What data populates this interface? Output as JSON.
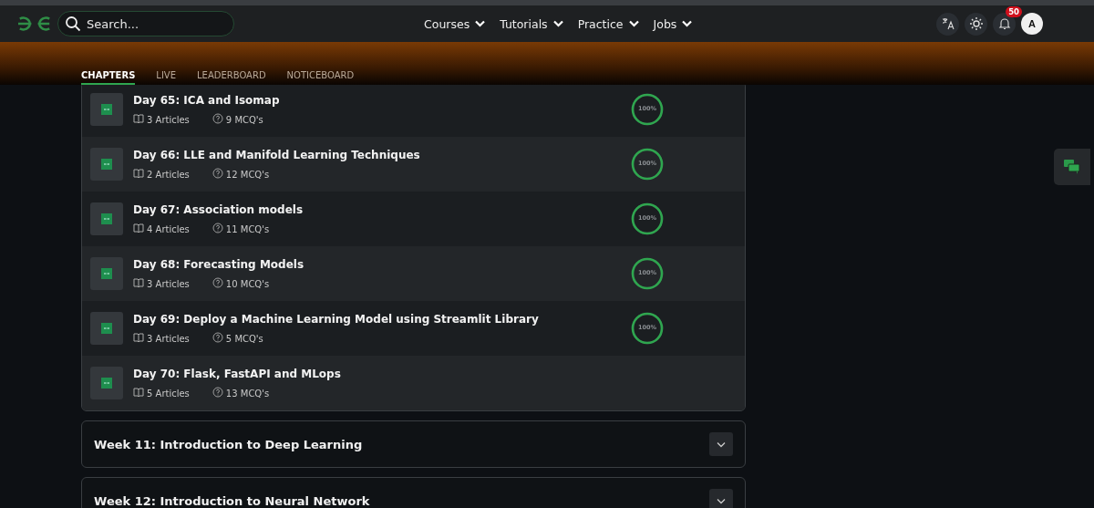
{
  "header": {
    "search": {
      "placeholder": "Search..."
    },
    "nav": [
      {
        "label": "Courses"
      },
      {
        "label": "Tutorials"
      },
      {
        "label": "Practice"
      },
      {
        "label": "Jobs"
      }
    ],
    "notifications": "50",
    "avatar": "A"
  },
  "tabs": [
    {
      "label": "CHAPTERS",
      "selected": true
    },
    {
      "label": "LIVE",
      "selected": false
    },
    {
      "label": "LEADERBOARD",
      "selected": false
    },
    {
      "label": "NOTICEBOARD",
      "selected": false
    }
  ],
  "chapters": [
    {
      "title": "Day 65: ICA and Isomap",
      "articles": "3 Articles",
      "mcqs": "9 MCQ's",
      "progress": {
        "label": "100%",
        "level": 1
      }
    },
    {
      "title": "Day 66: LLE and Manifold Learning Techniques",
      "articles": "2 Articles",
      "mcqs": "12 MCQ's",
      "progress": {
        "label": "100%",
        "level": 1
      }
    },
    {
      "title": "Day 67: Association models",
      "articles": "4 Articles",
      "mcqs": "11 MCQ's",
      "progress": {
        "label": "100%",
        "level": 1
      }
    },
    {
      "title": "Day 68: Forecasting Models",
      "articles": "3 Articles",
      "mcqs": "10 MCQ's",
      "progress": {
        "label": "100%",
        "level": 1
      }
    },
    {
      "title": "Day 69: Deploy a Machine Learning Model using Streamlit Library",
      "articles": "3 Articles",
      "mcqs": "5 MCQ's",
      "progress": {
        "label": "100%",
        "level": 1
      }
    },
    {
      "title": "Day 70: Flask, FastAPI and MLops",
      "articles": "5 Articles",
      "mcqs": "13 MCQ's"
    }
  ],
  "weeks": [
    {
      "title": "Week 11: Introduction to Deep Learning",
      "expanded": false
    },
    {
      "title": "Week 12: Introduction to Neural Network",
      "expanded": false
    }
  ]
}
